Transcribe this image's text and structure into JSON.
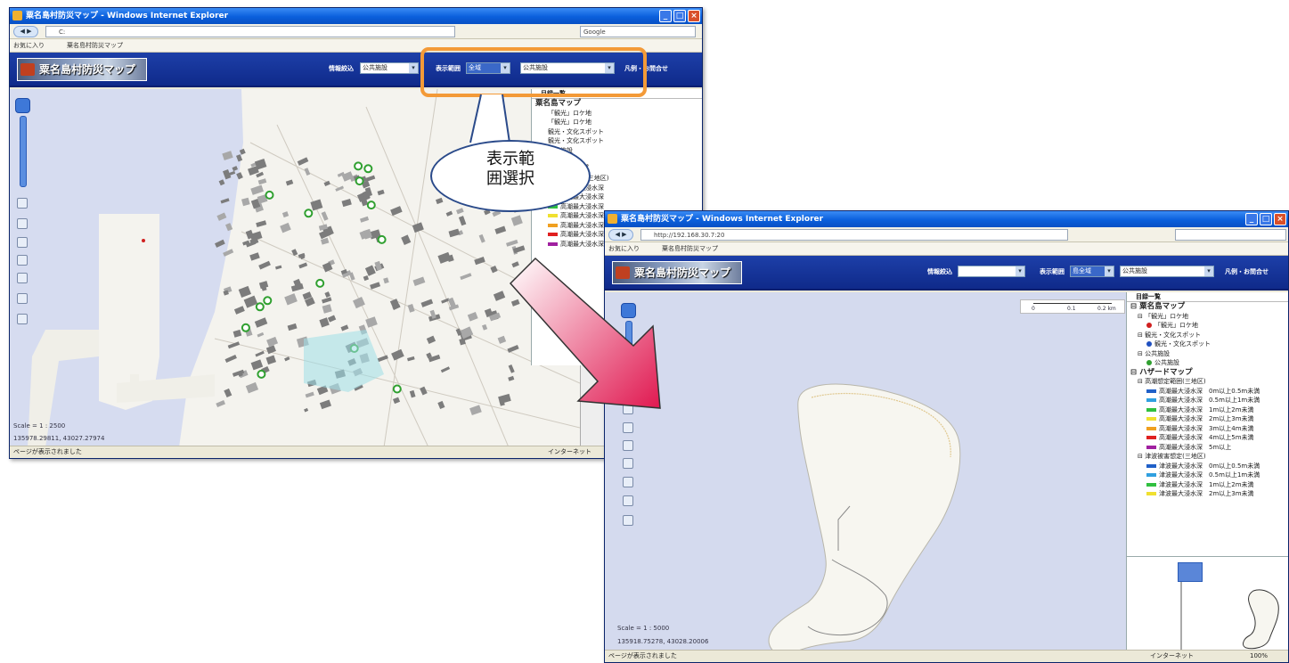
{
  "window1": {
    "title": "粟名島村防災マップ - Windows Internet Explorer",
    "address": "C:",
    "search": "Google",
    "favorites_label": "お気に入り",
    "favorites_tab": "粟名島村防災マップ",
    "app_title": "粟名島村防災マップ",
    "label_info": "情報絞込",
    "select_info": "公共施設",
    "label_range": "表示範囲",
    "select_range": "全域",
    "select_area": "公共施設",
    "link_help": "凡例・お問合せ",
    "scale_text": "Scale = 1 : 2500",
    "coord_text": "135978.29811, 43027.27974",
    "status_text": "ページが表示されました",
    "status_zone": "インターネット",
    "legend": {
      "title": "目録一覧",
      "items": [
        "粟名島マップ",
        "「観光」ロケ地",
        "「観光」ロケ地",
        "観光・文化スポット",
        "観光・文化スポット",
        "公共施設",
        "公共施設",
        "ハザードマップ",
        "高潮想定範囲(三地区)",
        "高潮最大浸水深",
        "高潮最大浸水深",
        "高潮最大浸水深",
        "高潮最大浸水深",
        "高潮最大浸水深",
        "高潮最大浸水深",
        "高潮最大浸水深"
      ]
    }
  },
  "window2": {
    "title": "粟名島村防災マップ - Windows Internet Explorer",
    "address": "http://192.168.30.7:20",
    "favorites_label": "お気に入り",
    "favorites_tab": "粟名島村防災マップ",
    "app_title": "粟名島村防災マップ",
    "label_info": "情報絞込",
    "select_info": "",
    "label_range": "表示範囲",
    "select_range": "島全域",
    "select_area": "公共施設",
    "link_help": "凡例・お問合せ",
    "scale_ticks": [
      "0",
      "0.1",
      "0.2 km"
    ],
    "scale_text": "Scale = 1 : 5000",
    "coord_text": "135918.75278, 43028.20006",
    "status_text": "ページが表示されました",
    "status_zone": "インターネット",
    "zoom_text": "100%",
    "legend": {
      "title": "目録一覧",
      "items": [
        {
          "label": "粟名島マップ",
          "kind": "group"
        },
        {
          "label": "「観光」ロケ地",
          "kind": "layer"
        },
        {
          "label": "「観光」ロケ地",
          "kind": "dot",
          "color": "#d02020"
        },
        {
          "label": "観光・文化スポット",
          "kind": "layer"
        },
        {
          "label": "観光・文化スポット",
          "kind": "dot",
          "color": "#2050c0"
        },
        {
          "label": "公共施設",
          "kind": "layer"
        },
        {
          "label": "公共施設",
          "kind": "dot",
          "color": "#30a030"
        },
        {
          "label": "ハザードマップ",
          "kind": "group"
        },
        {
          "label": "高潮想定範囲(三地区)",
          "kind": "layer"
        },
        {
          "label": "高潮最大浸水深　0m以上0.5m未満",
          "kind": "swatch",
          "color": "#2060c8"
        },
        {
          "label": "高潮最大浸水深　0.5m以上1m未満",
          "kind": "swatch",
          "color": "#30a0e0"
        },
        {
          "label": "高潮最大浸水深　1m以上2m未満",
          "kind": "swatch",
          "color": "#30c040"
        },
        {
          "label": "高潮最大浸水深　2m以上3m未満",
          "kind": "swatch",
          "color": "#f0e030"
        },
        {
          "label": "高潮最大浸水深　3m以上4m未満",
          "kind": "swatch",
          "color": "#f0a020"
        },
        {
          "label": "高潮最大浸水深　4m以上5m未満",
          "kind": "swatch",
          "color": "#e02020"
        },
        {
          "label": "高潮最大浸水深　5m以上",
          "kind": "swatch",
          "color": "#a020a0"
        },
        {
          "label": "津波被害想定(三地区)",
          "kind": "layer"
        },
        {
          "label": "津波最大浸水深　0m以上0.5m未満",
          "kind": "swatch",
          "color": "#2060c8"
        },
        {
          "label": "津波最大浸水深　0.5m以上1m未満",
          "kind": "swatch",
          "color": "#30a0e0"
        },
        {
          "label": "津波最大浸水深　1m以上2m未満",
          "kind": "swatch",
          "color": "#30c040"
        },
        {
          "label": "津波最大浸水深　2m以上3m未満",
          "kind": "swatch",
          "color": "#f0e030"
        }
      ]
    }
  },
  "callout": {
    "text_line1": "表示範",
    "text_line2": "囲選択",
    "border_color": "#f39a38"
  },
  "arrow": {
    "gradient_start": "#ffffff",
    "gradient_end": "#e01850"
  }
}
